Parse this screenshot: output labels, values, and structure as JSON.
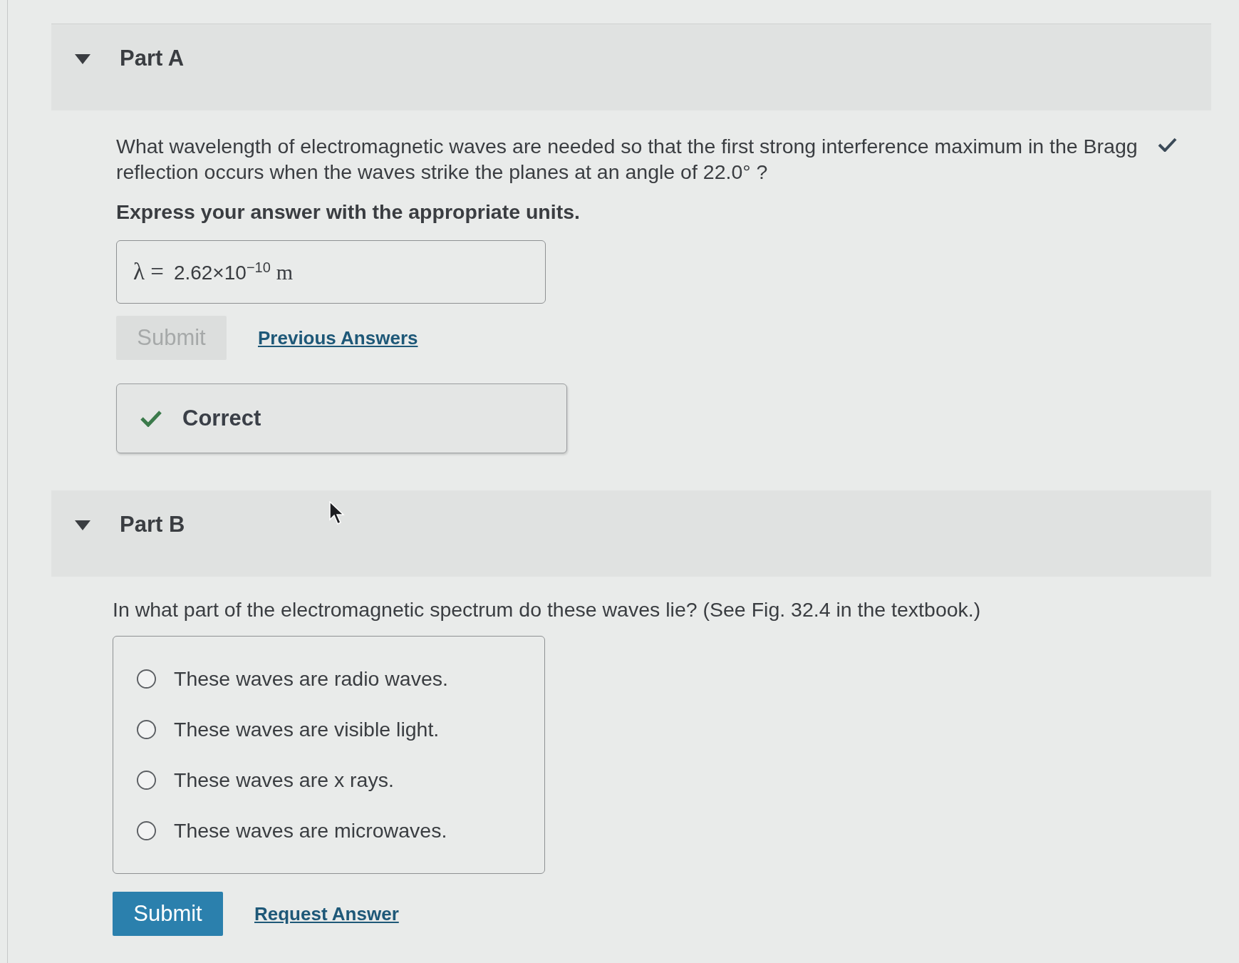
{
  "parts": [
    {
      "title": "Part A",
      "expanded": true,
      "completed": true,
      "question": "What wavelength of electromagnetic waves are needed so that the first strong interference maximum in the Bragg reflection occurs when the waves strike the planes at an angle of 22.0° ?",
      "instruction": "Express your answer with the appropriate units.",
      "answer": {
        "label": "λ =",
        "value": "2.62×10$^{−10}$",
        "unit": "m"
      },
      "submit": {
        "label": "Submit",
        "disabled": true
      },
      "link": "Previous Answers",
      "feedback": {
        "kind": "correct",
        "text": "Correct"
      }
    },
    {
      "title": "Part B",
      "expanded": true,
      "completed": false,
      "question": "In what part of the electromagnetic spectrum do these waves lie? (See Fig. 32.4 in the textbook.)",
      "options": [
        {
          "label": "These waves are radio waves.",
          "selected": false
        },
        {
          "label": "These waves are visible light.",
          "selected": false
        },
        {
          "label": "These waves are x rays.",
          "selected": false
        },
        {
          "label": "These waves are microwaves.",
          "selected": false
        }
      ],
      "submit": {
        "label": "Submit",
        "disabled": false
      },
      "link": "Request Answer"
    }
  ]
}
